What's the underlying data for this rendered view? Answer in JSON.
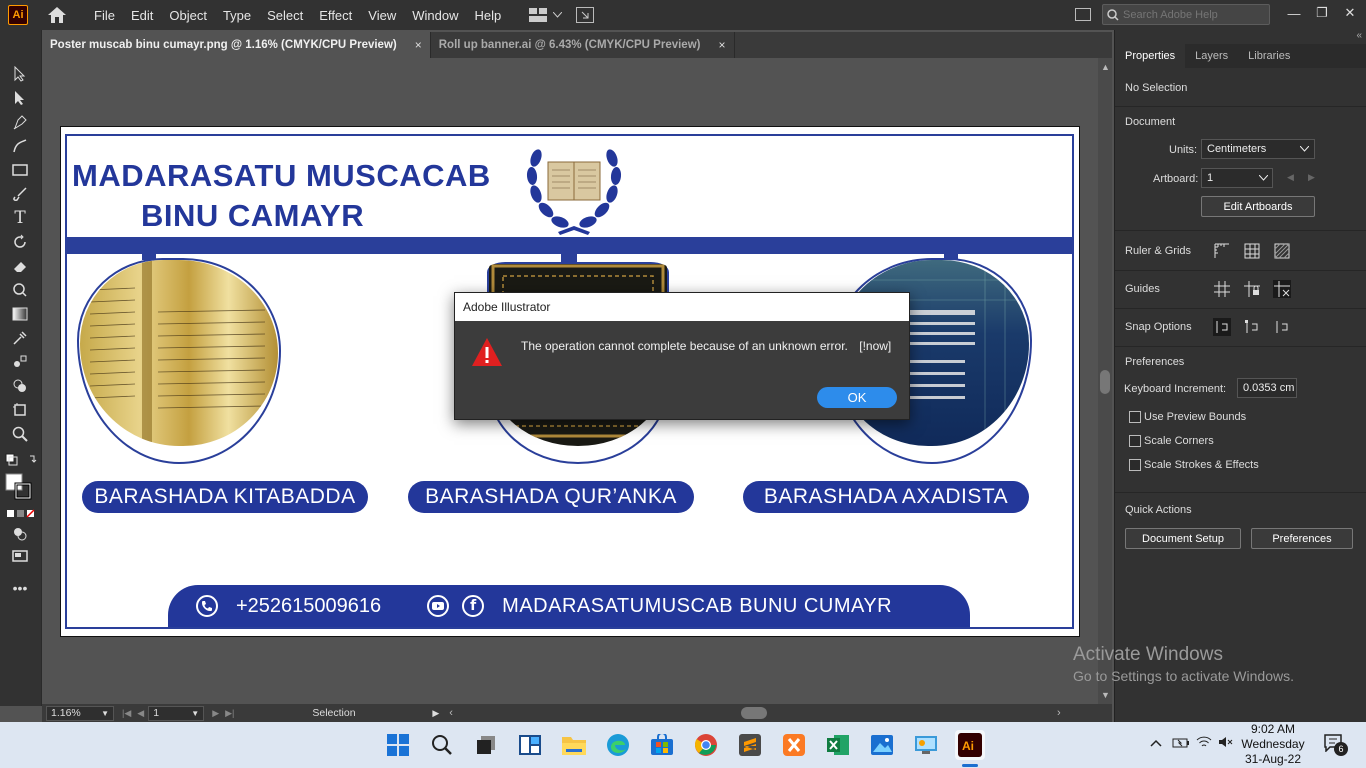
{
  "app": {
    "logo": "Ai",
    "menu": [
      "File",
      "Edit",
      "Object",
      "Type",
      "Select",
      "Effect",
      "View",
      "Window",
      "Help"
    ]
  },
  "search": {
    "placeholder": "Search Adobe Help"
  },
  "tabs": [
    {
      "label": "Poster muscab binu cumayr.png @ 1.16% (CMYK/CPU Preview)",
      "close": "×",
      "active": true
    },
    {
      "label": "Roll up banner.ai @ 6.43% (CMYK/CPU Preview)",
      "close": "×",
      "active": false
    }
  ],
  "poster": {
    "title_line1": "MADARASATU MUSCACAB",
    "title_line2": "BINU CAMAYR",
    "pill1": "BARASHADA KITABADDA",
    "pill2": "BARASHADA QUR’ANKA",
    "pill3": "BARASHADA AXADISTA",
    "phone": "+252615009616",
    "social": "MADARASATUMUSCAB BUNU CUMAYR"
  },
  "dialog": {
    "title": "Adobe Illustrator",
    "message": "The operation cannot complete because of an unknown error.",
    "code": "[!now]",
    "ok": "OK"
  },
  "status": {
    "zoom": "1.16%",
    "artboard": "1",
    "tool": "Selection"
  },
  "panel": {
    "tabs": [
      "Properties",
      "Layers",
      "Libraries"
    ],
    "selection": "No Selection",
    "document": "Document",
    "units_label": "Units:",
    "units_value": "Centimeters",
    "artboard_label": "Artboard:",
    "artboard_value": "1",
    "edit_artboards": "Edit Artboards",
    "ruler_grids": "Ruler & Grids",
    "guides": "Guides",
    "snap_options": "Snap Options",
    "preferences": "Preferences",
    "keyboard_increment_label": "Keyboard Increment:",
    "keyboard_increment_value": "0.0353 cm",
    "use_preview_bounds": "Use Preview Bounds",
    "scale_corners": "Scale Corners",
    "scale_strokes": "Scale Strokes & Effects",
    "quick_actions": "Quick Actions",
    "document_setup": "Document Setup",
    "preferences_btn": "Preferences"
  },
  "watermark": {
    "line1": "Activate Windows",
    "line2": "Go to Settings to activate Windows."
  },
  "clock": {
    "time": "9:02 AM",
    "day": "Wednesday",
    "date": "31-Aug-22"
  },
  "notifications": "6",
  "colors": {
    "accent": "#23379a",
    "ok_button": "#2d8ceb",
    "warning": "#e02020"
  }
}
